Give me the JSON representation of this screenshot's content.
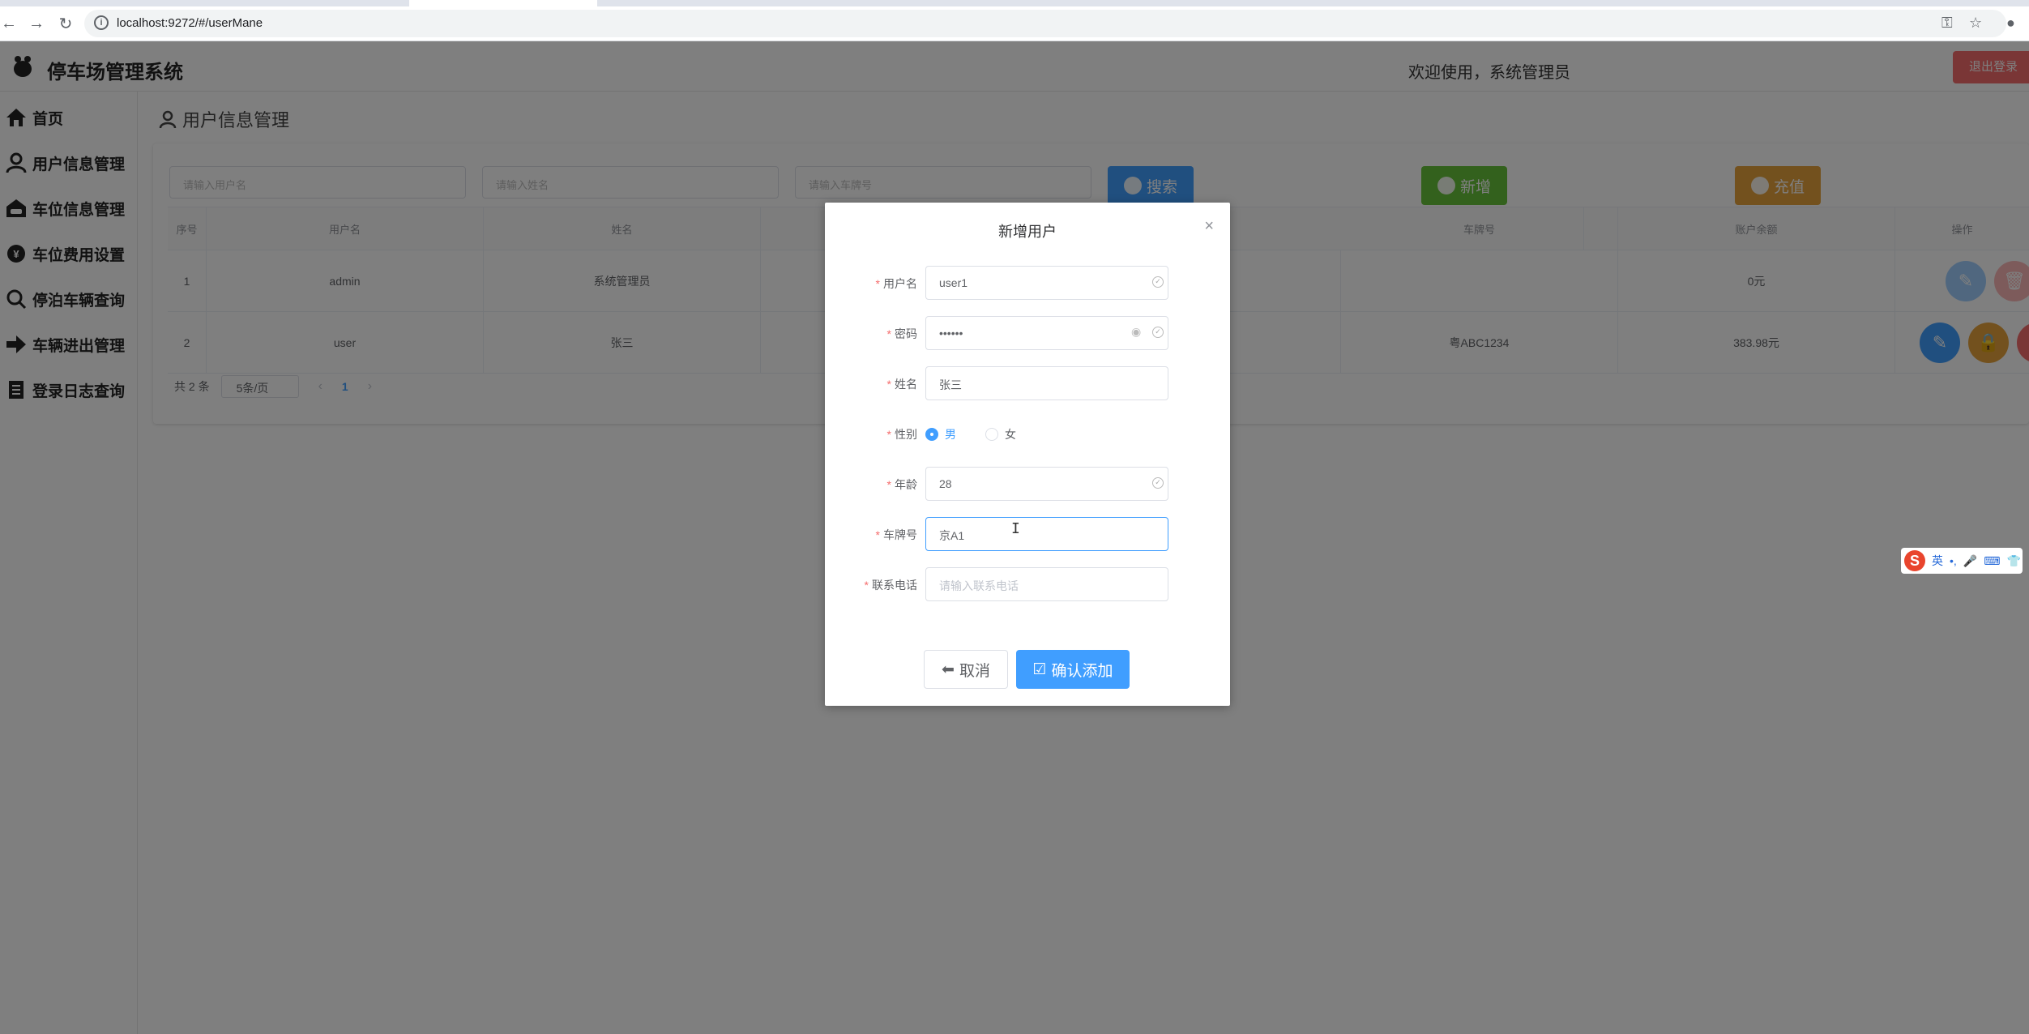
{
  "browser": {
    "url": "localhost:9272/#/userMane"
  },
  "header": {
    "title": "停车场管理系统",
    "welcome": "欢迎使用，系统管理员",
    "logout_label": "退出登录"
  },
  "sidebar": {
    "items": [
      {
        "label": "首页",
        "icon": "home-icon"
      },
      {
        "label": "用户信息管理",
        "icon": "user-icon"
      },
      {
        "label": "车位信息管理",
        "icon": "parking-icon"
      },
      {
        "label": "车位费用设置",
        "icon": "fee-icon"
      },
      {
        "label": "停泊车辆查询",
        "icon": "search-icon"
      },
      {
        "label": "车辆进出管理",
        "icon": "arrow-right-icon"
      },
      {
        "label": "登录日志查询",
        "icon": "log-icon"
      }
    ]
  },
  "main": {
    "page_title": "用户信息管理",
    "search": {
      "username_placeholder": "请输入用户名",
      "name_placeholder": "请输入姓名",
      "plate_placeholder": "请输入车牌号",
      "search_label": "搜索",
      "add_label": "新增",
      "recharge_label": "充值"
    },
    "table": {
      "columns": [
        "序号",
        "用户名",
        "姓名",
        "车牌号",
        "账户余额",
        "操作"
      ],
      "rows": [
        {
          "index": "1",
          "username": "admin",
          "name": "系统管理员",
          "plate": "",
          "balance": "0元"
        },
        {
          "index": "2",
          "username": "user",
          "name": "张三",
          "plate": "粤ABC1234",
          "balance": "383.98元"
        }
      ]
    },
    "pager": {
      "total": "共 2 条",
      "page_size": "5条/页",
      "current_page": "1"
    }
  },
  "dialog": {
    "title": "新增用户",
    "fields": {
      "username": {
        "label": "用户名",
        "value": "user1"
      },
      "password": {
        "label": "密码",
        "value": "••••••"
      },
      "name": {
        "label": "姓名",
        "value": "张三"
      },
      "gender": {
        "label": "性别",
        "option_male": "男",
        "option_female": "女",
        "selected": "男"
      },
      "age": {
        "label": "年龄",
        "value": "28"
      },
      "plate": {
        "label": "车牌号",
        "value": "京A1"
      },
      "phone": {
        "label": "联系电话",
        "placeholder": "请输入联系电话"
      }
    },
    "cancel_label": "取消",
    "confirm_label": "确认添加"
  },
  "ime": {
    "lang": "英"
  },
  "colors": {
    "primary": "#409eff",
    "success": "#67c23a",
    "warning": "#e6a23c",
    "danger": "#f56c6c"
  }
}
